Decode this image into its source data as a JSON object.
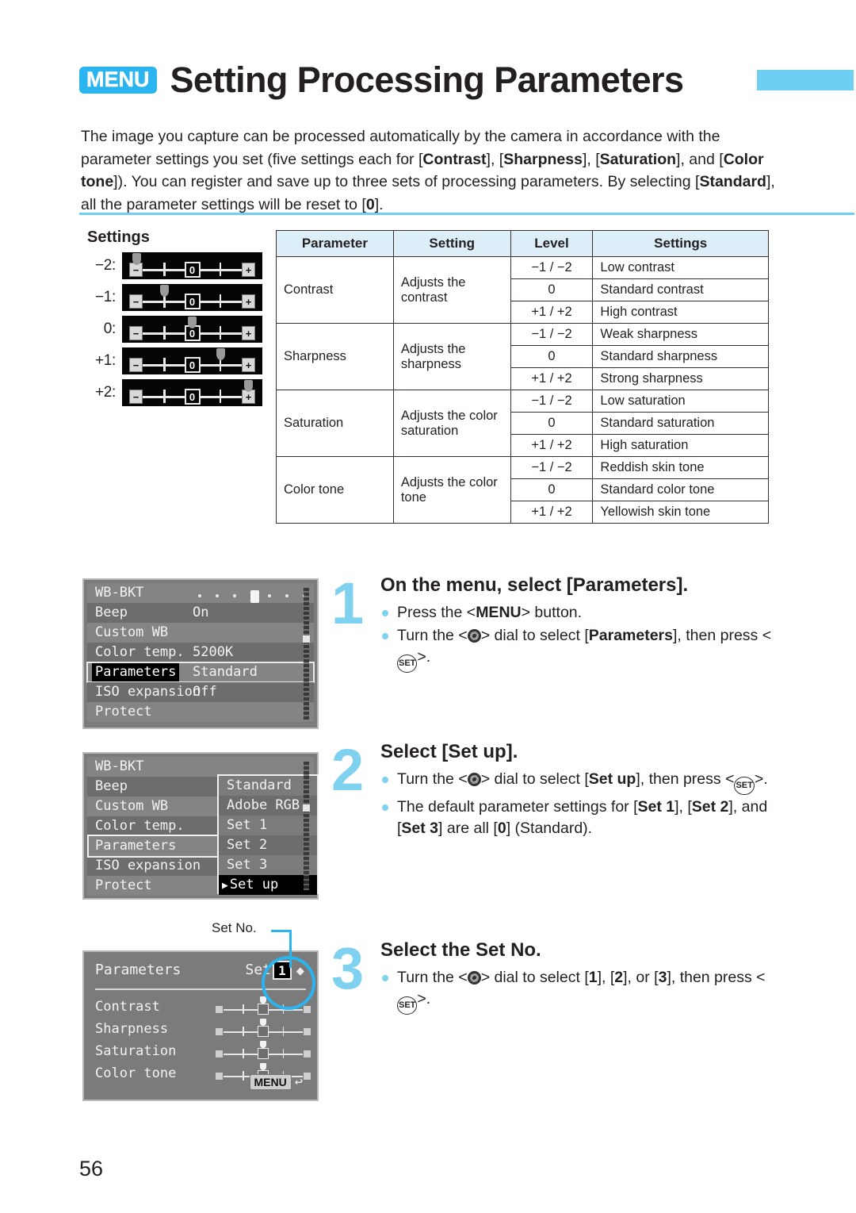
{
  "header": {
    "menu_badge": "MENU",
    "title": "Setting Processing Parameters"
  },
  "intro": {
    "line1_a": "The image you capture can be processed automatically by the camera in accordance with the",
    "line2_a": "parameter settings you set (five settings each for [",
    "b_contrast": "Contrast",
    "line2_b": "], [",
    "b_sharpness": "Sharpness",
    "line2_c": "], [",
    "b_saturation": "Saturation",
    "line2_d": "], and",
    "line3_a": "[",
    "b_colortone": "Color tone",
    "line3_b": "]). You can register and save up to three sets of processing parameters.",
    "line4_a": "By selecting [",
    "b_standard": "Standard",
    "line4_b": "], all the parameter settings will be reset to [",
    "b_zero": "0",
    "line4_c": "]."
  },
  "settings_legend": {
    "heading": "Settings",
    "rows": [
      {
        "label": "−2:",
        "position": 0
      },
      {
        "label": "−1:",
        "position": 1
      },
      {
        "label": "0:",
        "position": 2
      },
      {
        "label": "+1:",
        "position": 3
      },
      {
        "label": "+2:",
        "position": 4
      }
    ],
    "slider_marks": {
      "minus": "−",
      "zero": "0",
      "plus": "+"
    }
  },
  "table": {
    "headers": [
      "Parameter",
      "Setting",
      "Level",
      "Settings"
    ],
    "groups": [
      {
        "parameter": "Contrast",
        "setting": "Adjusts the contrast",
        "levels": [
          {
            "level": "−1 / −2",
            "settings": "Low contrast"
          },
          {
            "level": "0",
            "settings": "Standard contrast"
          },
          {
            "level": "+1 / +2",
            "settings": "High contrast"
          }
        ]
      },
      {
        "parameter": "Sharpness",
        "setting": "Adjusts the sharpness",
        "levels": [
          {
            "level": "−1 / −2",
            "settings": "Weak sharpness"
          },
          {
            "level": "0",
            "settings": "Standard sharpness"
          },
          {
            "level": "+1 / +2",
            "settings": "Strong sharpness"
          }
        ]
      },
      {
        "parameter": "Saturation",
        "setting": "Adjusts the color saturation",
        "levels": [
          {
            "level": "−1 / −2",
            "settings": "Low saturation"
          },
          {
            "level": "0",
            "settings": "Standard saturation"
          },
          {
            "level": "+1 / +2",
            "settings": "High saturation"
          }
        ]
      },
      {
        "parameter": "Color tone",
        "setting": "Adjusts the color tone",
        "levels": [
          {
            "level": "−1 / −2",
            "settings": "Reddish skin tone"
          },
          {
            "level": "0",
            "settings": "Standard color tone"
          },
          {
            "level": "+1 / +2",
            "settings": "Yellowish skin tone"
          }
        ]
      }
    ]
  },
  "lcd1": {
    "rows": [
      {
        "label": "WB-BKT",
        "value": ""
      },
      {
        "label": "Beep",
        "value": "On"
      },
      {
        "label": "Custom WB",
        "value": ""
      },
      {
        "label": "Color temp.",
        "value": "5200K"
      },
      {
        "label": "Parameters",
        "value": "Standard"
      },
      {
        "label": "ISO expansion",
        "value": "Off"
      },
      {
        "label": "Protect",
        "value": ""
      }
    ],
    "selected_row": "Parameters"
  },
  "lcd2": {
    "rows": [
      {
        "label": "WB-BKT",
        "value": ""
      },
      {
        "label": "Beep",
        "value": ""
      },
      {
        "label": "Custom WB",
        "value": ""
      },
      {
        "label": "Color temp.",
        "value": ""
      },
      {
        "label": "Parameters",
        "value": ""
      },
      {
        "label": "ISO expansion",
        "value": ""
      },
      {
        "label": "Protect",
        "value": ""
      }
    ],
    "dropdown": {
      "items": [
        "Standard",
        "Adobe RGB",
        "Set 1",
        "Set 2",
        "Set 3",
        "Set up"
      ],
      "selected": "Set up",
      "selected_arrow": "▶"
    }
  },
  "lcd3": {
    "title": "Parameters",
    "set_label": "Set",
    "set_number": "1",
    "updown_icon": "⬍",
    "params": [
      {
        "name": "Contrast",
        "value": 0
      },
      {
        "name": "Sharpness",
        "value": 0
      },
      {
        "name": "Saturation",
        "value": 0
      },
      {
        "name": "Color tone",
        "value": 0
      }
    ],
    "menu_return": {
      "label": "MENU",
      "arrow": "↩"
    }
  },
  "callout": {
    "label": "Set No."
  },
  "steps": [
    {
      "number": "1",
      "title": "On the menu, select [Parameters].",
      "bullets": [
        {
          "pre": "Press the <",
          "icon": "menu-text",
          "icon_text": "MENU",
          "mid": "> button.",
          "post": ""
        },
        {
          "pre": "Turn the <",
          "icon": "dial",
          "mid": "> dial to select [",
          "bold": "Parameters",
          "mid2": "], then press <",
          "icon2": "set",
          "post": ">."
        }
      ]
    },
    {
      "number": "2",
      "title": "Select [Set up].",
      "bullets": [
        {
          "pre": "Turn the <",
          "icon": "dial",
          "mid": "> dial to select [",
          "bold": "Set up",
          "mid2": "], then press <",
          "icon2": "set",
          "post": ">."
        },
        {
          "pre": "The default parameter settings for [",
          "bold": "Set 1",
          "mid": "], [",
          "bold2": "Set 2",
          "mid2": "], and [",
          "bold3": "Set 3",
          "mid3": "] are all [",
          "bold4": "0",
          "post": "] (Standard)."
        }
      ]
    },
    {
      "number": "3",
      "title": "Select the Set No.",
      "bullets": [
        {
          "pre": "Turn the <",
          "icon": "dial",
          "mid": "> dial to select [",
          "bold": "1",
          "mid2": "], [",
          "bold2": "2",
          "mid3": "], or [",
          "bold3": "3",
          "post": "], then press <",
          "icon2": "set",
          "tail": ">."
        }
      ]
    }
  ],
  "set_button_label": "SET",
  "menu_button_label": "MENU",
  "page_number": "56",
  "colors": {
    "accent_blue": "#2BB5F0",
    "light_blue": "#7FD1F0",
    "table_header_blue": "#DCEEF8",
    "lcd_gray": "#7b7b7b",
    "text": "#231f20"
  }
}
